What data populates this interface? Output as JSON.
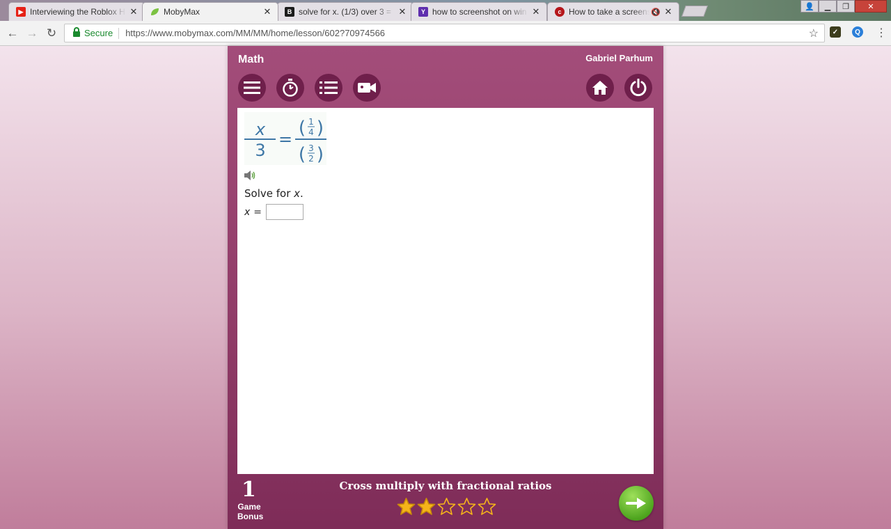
{
  "browser": {
    "tabs": [
      {
        "title": "Interviewing the Roblox H",
        "favicon": "youtube-icon"
      },
      {
        "title": "MobyMax",
        "favicon": "mobymax-leaf-icon",
        "active": true
      },
      {
        "title": "solve for x. (1/3) over 3 =",
        "favicon": "brainly-icon"
      },
      {
        "title": "how to screenshot on win",
        "favicon": "yahoo-icon"
      },
      {
        "title": "How to take a screens",
        "favicon": "cnet-icon"
      }
    ],
    "security_label": "Secure",
    "url": "https://www.mobymax.com/MM/MM/home/lesson/602?70974566"
  },
  "app": {
    "subject": "Math",
    "user_name": "Gabriel Parhum",
    "toolbar_icons": [
      "menu-icon",
      "timer-icon",
      "list-icon",
      "video-icon",
      "home-icon",
      "power-icon"
    ],
    "equation": {
      "left_numerator": "x",
      "left_denominator": "3",
      "equals": "=",
      "right_numerator": "(1/4)",
      "right_denominator": "(3/2)"
    },
    "prompt_text": "Solve for",
    "prompt_var": "x",
    "prompt_end": ".",
    "answer_label_var": "x",
    "answer_label_eq": "=",
    "answer_value": "",
    "game_bonus_count": "1",
    "game_bonus_label_1": "Game",
    "game_bonus_label_2": "Bonus",
    "lesson_title": "Cross multiply with fractional ratios",
    "stars_filled": 2,
    "stars_total": 5,
    "colors": {
      "app_bg": "#a14d78",
      "button_bg": "#6f1f4b",
      "math_blue": "#3e77a6",
      "next_green": "#4fa51f",
      "star_gold": "#f5b41a"
    }
  }
}
